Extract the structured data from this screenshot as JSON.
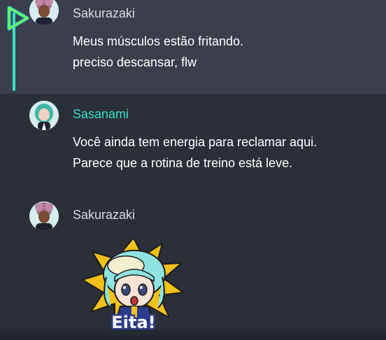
{
  "messages": [
    {
      "author": "Sakurazaki",
      "lines": [
        "Meus músculos estão fritando.",
        "preciso descansar, flw"
      ],
      "highlighted": true
    },
    {
      "author": "Sasanami",
      "lines": [
        "Você ainda tem energia para reclamar aqui.",
        "Parece que a rotina de treino está leve."
      ],
      "highlighted": false
    },
    {
      "author": "Sakurazaki",
      "sticker": {
        "caption": "Eita!"
      },
      "highlighted": false
    }
  ],
  "colors": {
    "background": "#2b2f38",
    "highlight_background": "#3a3f4b",
    "accent": "#33e0c8",
    "name_default": "#d8dbe0",
    "text": "#ffffff"
  },
  "icons": {
    "current_message_marker": "play-arrow-icon"
  }
}
